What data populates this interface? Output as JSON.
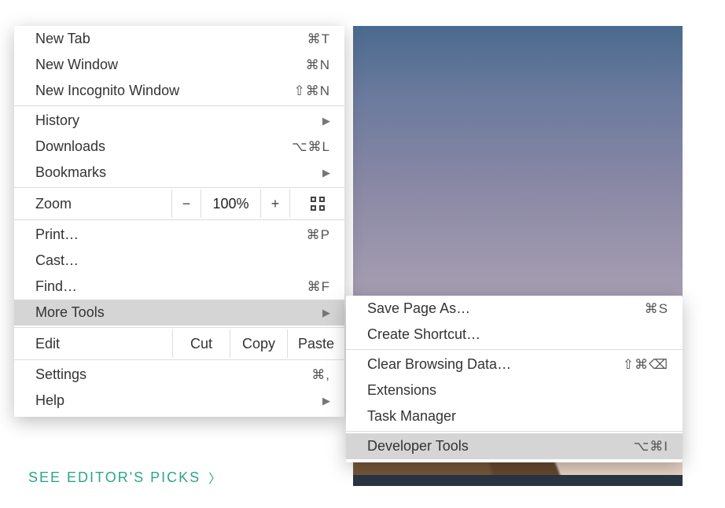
{
  "mainMenu": {
    "newTab": {
      "label": "New Tab",
      "shortcut": "⌘T"
    },
    "newWindow": {
      "label": "New Window",
      "shortcut": "⌘N"
    },
    "newIncognito": {
      "label": "New Incognito Window",
      "shortcut": "⇧⌘N"
    },
    "history": {
      "label": "History"
    },
    "downloads": {
      "label": "Downloads",
      "shortcut": "⌥⌘L"
    },
    "bookmarks": {
      "label": "Bookmarks"
    },
    "zoom": {
      "label": "Zoom",
      "value": "100%",
      "minus": "−",
      "plus": "+"
    },
    "print": {
      "label": "Print…",
      "shortcut": "⌘P"
    },
    "cast": {
      "label": "Cast…"
    },
    "find": {
      "label": "Find…",
      "shortcut": "⌘F"
    },
    "moreTools": {
      "label": "More Tools"
    },
    "edit": {
      "label": "Edit",
      "cut": "Cut",
      "copy": "Copy",
      "paste": "Paste"
    },
    "settings": {
      "label": "Settings",
      "shortcut": "⌘,"
    },
    "help": {
      "label": "Help"
    }
  },
  "subMenu": {
    "savePageAs": {
      "label": "Save Page As…",
      "shortcut": "⌘S"
    },
    "createShortcut": {
      "label": "Create Shortcut…"
    },
    "clearBrowsing": {
      "label": "Clear Browsing Data…",
      "shortcut": "⇧⌘⌫"
    },
    "extensions": {
      "label": "Extensions"
    },
    "taskManager": {
      "label": "Task Manager"
    },
    "developerTools": {
      "label": "Developer Tools",
      "shortcut": "⌥⌘I"
    }
  },
  "editorsPicks": {
    "label": "SEE EDITOR'S PICKS"
  }
}
